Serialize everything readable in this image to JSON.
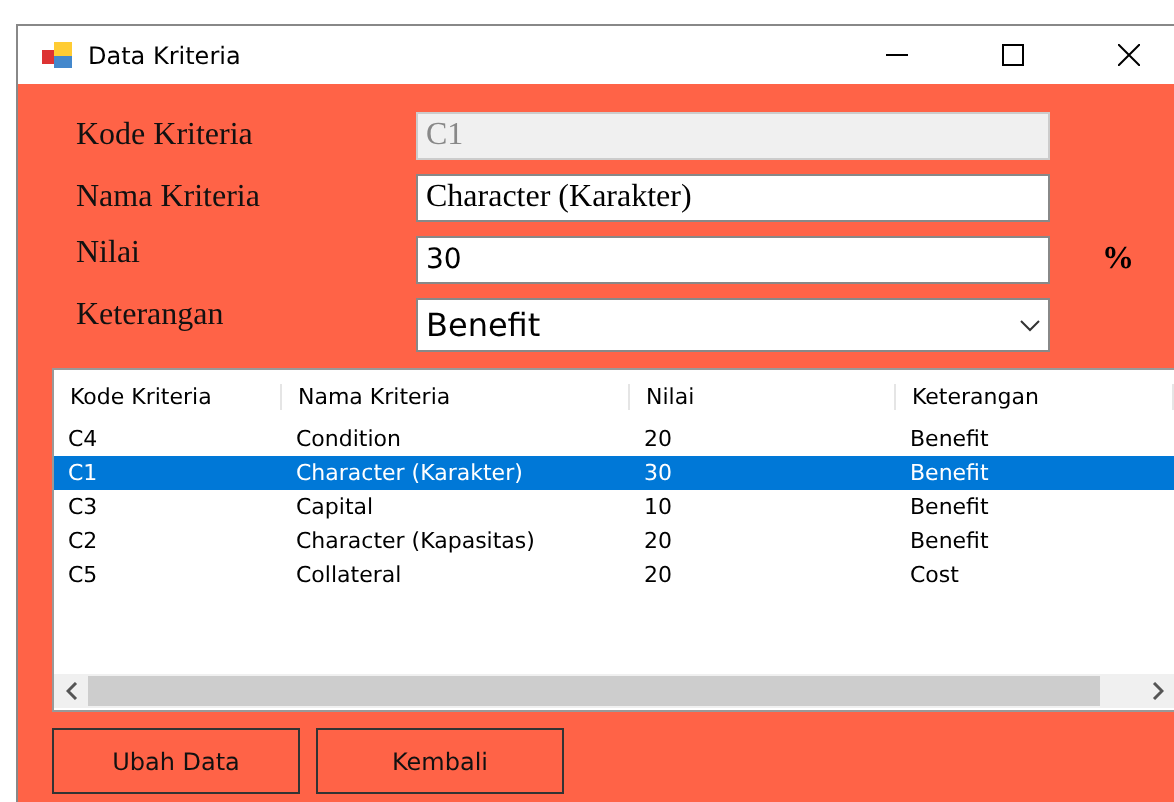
{
  "window": {
    "title": "Data Kriteria"
  },
  "form": [
    {
      "label": "Kode Kriteria",
      "kind": "text",
      "value": "C1",
      "disabled": true
    },
    {
      "label": "Nama Kriteria",
      "kind": "text",
      "value": "Character (Karakter)",
      "disabled": false
    },
    {
      "label": "Nilai",
      "kind": "text",
      "value": "30",
      "disabled": false,
      "unit": "%"
    },
    {
      "label": "Keterangan",
      "kind": "combo",
      "value": "Benefit",
      "disabled": false
    }
  ],
  "table": {
    "columns": [
      "Kode Kriteria",
      "Nama Kriteria",
      "Nilai",
      "Keterangan"
    ],
    "rows": [
      {
        "cells": [
          "C4",
          "Condition",
          "20",
          "Benefit"
        ],
        "selected": false
      },
      {
        "cells": [
          "C1",
          "Character (Karakter)",
          "30",
          "Benefit"
        ],
        "selected": true
      },
      {
        "cells": [
          "C3",
          "Capital",
          "10",
          "Benefit"
        ],
        "selected": false
      },
      {
        "cells": [
          "C2",
          "Character (Kapasitas)",
          "20",
          "Benefit"
        ],
        "selected": false
      },
      {
        "cells": [
          "C5",
          "Collateral",
          "20",
          "Cost"
        ],
        "selected": false
      }
    ]
  },
  "buttons": [
    "Ubah Data",
    "Kembali"
  ]
}
